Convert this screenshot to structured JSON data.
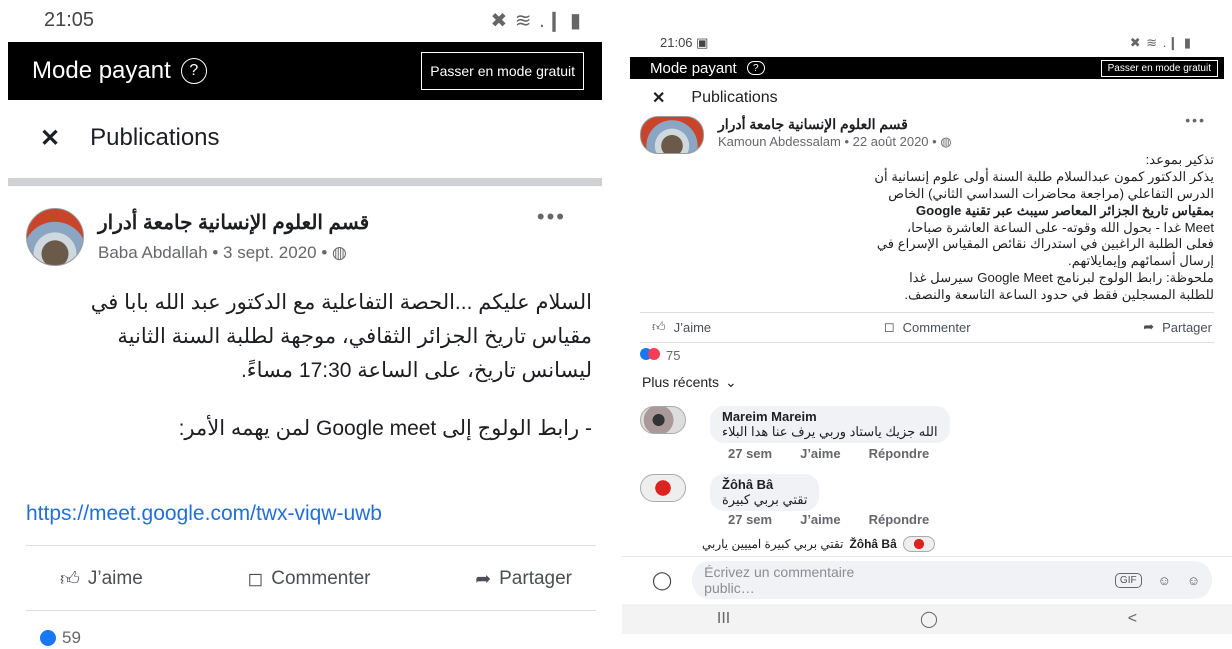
{
  "left": {
    "status_time": "21:05",
    "status_icons": "✖ ≋ .❙ ▮",
    "mode_title": "Mode payant",
    "help_glyph": "?",
    "gratuit_button": "Passer en mode gratuit",
    "close_glyph": "✕",
    "publications": "Publications",
    "page_name": "قسم العلوم الإنسانية جامعة أدرار",
    "author_line": "Baba Abdallah • 3 sept. 2020 • ◍",
    "more_glyph": "•••",
    "body_line1": "السلام عليكم ...الحصة التفاعلية مع الدكتور عبد الله بابا في",
    "body_line2": "مقياس تاريخ الجزائر الثقافي، موجهة لطلبة السنة الثانية",
    "body_line3": "ليسانس تاريخ، على الساعة 17:30 مساءً.",
    "body_line4": "- رابط الولوج إلى Google meet لمن يهمه الأمر:",
    "link": "https://meet.google.com/twx-viqw-uwb",
    "like_label": "J’aime",
    "comment_label": "Commenter",
    "share_label": "Partager",
    "reaction_count": "59"
  },
  "right": {
    "status_time": "21:06 ▣",
    "status_icons": "✖ ≋ .❙ ▮",
    "mode_title": "Mode payant",
    "help_glyph": "?",
    "gratuit_button": "Passer en mode gratuit",
    "close_glyph": "✕",
    "publications": "Publications",
    "page_name": "قسم العلوم الإنسانية جامعة أدرار",
    "author_line": "Kamoun Abdessalam • 22 août 2020 • ◍",
    "more_glyph": "•••",
    "body": [
      "تذكير بموعد:",
      "يذكر الدكتور كمون عبدالسلام طلبة السنة أولى علوم إنسانية أن",
      "الدرس التفاعلي (مراجعة محاضرات السداسي الثاني) الخاص",
      "بمقياس تاريخ الجزائر المعاصر سيبث عبر تقنية Google",
      "Meet غدا - بحول الله وقوته- على الساعة العاشرة صباحا،",
      "فعلى الطلبة الراغبين في استدراك نقائص المقياس الإسراع في",
      "إرسال أسمائهم وإيمايلاتهم.",
      "ملحوظة: رابط الولوج لبرنامج Google Meet سيرسل غدا",
      "للطلبة المسجلين فقط في حدود الساعة التاسعة والنصف."
    ],
    "like_label": "J’aime",
    "comment_label": "Commenter",
    "share_label": "Partager",
    "reaction_count": "75",
    "recents": "Plus récents",
    "comments": [
      {
        "name": "Mareim Mareim",
        "text": "الله جزيك ياستاد وربي يرف عنا هدا البلاء",
        "age": "27 sem",
        "like": "J’aime",
        "reply": "Répondre"
      },
      {
        "name": "Žôhâ Bâ",
        "text": "تقتي بربي كبيرة",
        "age": "27 sem",
        "like": "J’aime",
        "reply": "Répondre"
      }
    ],
    "reply_name": "Žôhâ Bâ",
    "reply_text": "تقتي بربي كبيرة امييين ياربي",
    "composer_placeholder": "Écrivez un commentaire public…",
    "gif_label": "GIF",
    "nav_recent": "III",
    "nav_home": "◯",
    "nav_back": "<"
  }
}
